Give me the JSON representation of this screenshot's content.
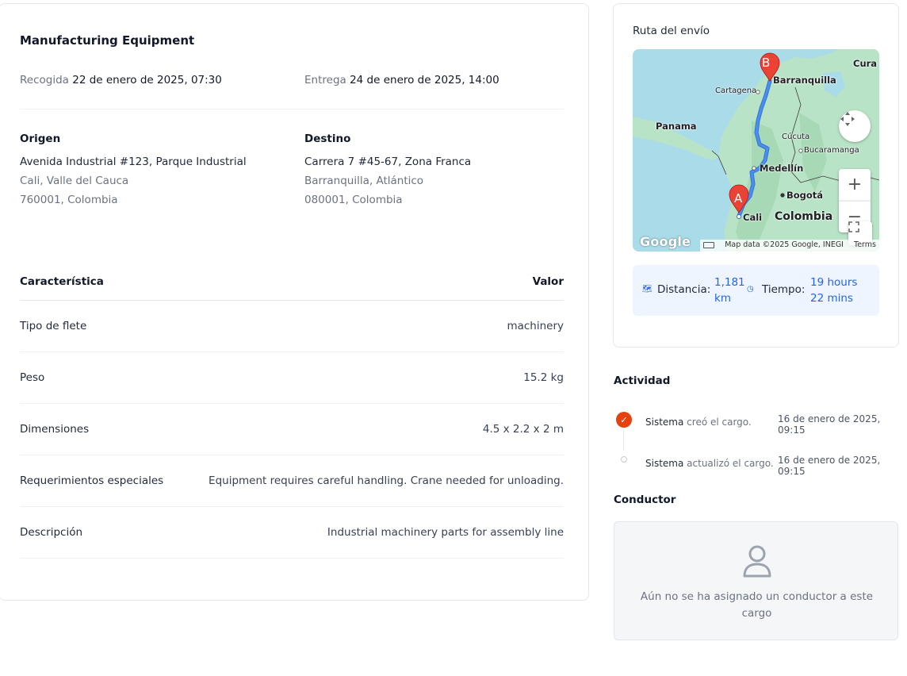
{
  "cargo": {
    "title": "Manufacturing Equipment",
    "pickup_label": "Recogida",
    "pickup_value": "22 de enero de 2025, 07:30",
    "delivery_label": "Entrega",
    "delivery_value": "24 de enero de 2025, 14:00"
  },
  "origin": {
    "heading": "Origen",
    "line1": "Avenida Industrial #123, Parque Industrial",
    "line2": "Cali, Valle del Cauca",
    "line3": "760001, Colombia"
  },
  "destination": {
    "heading": "Destino",
    "line1": "Carrera 7 #45-67, Zona Franca",
    "line2": "Barranquilla, Atlántico",
    "line3": "080001, Colombia"
  },
  "specs": {
    "col_key": "Característica",
    "col_value": "Valor",
    "rows": [
      {
        "key": "Tipo de flete",
        "value": "machinery"
      },
      {
        "key": "Peso",
        "value": "15.2 kg"
      },
      {
        "key": "Dimensiones",
        "value": "4.5 x 2.2 x 2 m"
      },
      {
        "key": "Requerimientos especiales",
        "value": "Equipment requires careful handling. Crane needed for unloading."
      },
      {
        "key": "Descripción",
        "value": "Industrial machinery parts for assembly line"
      }
    ]
  },
  "route": {
    "title": "Ruta del envío",
    "map": {
      "labels": {
        "cura": "Cura",
        "barranquilla": "Barranquilla",
        "cartagena": "Cartagena",
        "panama": "Panama",
        "cucuta": "Cúcuta",
        "bucaramanga": "Bucaramanga",
        "medellin": "Medellín",
        "bogota": "Bogotá",
        "cali": "Cali",
        "colombia": "Colombia"
      },
      "marker_a": "A",
      "marker_b": "B",
      "zoom_in": "+",
      "zoom_out": "−",
      "logo": "Google",
      "attribution": "Map data ©2025 Google, INEGI",
      "terms": "Terms"
    },
    "distance_label": "Distancia:",
    "distance_value": "1,181 km",
    "time_label": "Tiempo:",
    "time_value": "19 hours 22 mins"
  },
  "activity": {
    "title": "Actividad",
    "items": [
      {
        "actor": "Sistema",
        "verb": "creó el cargo.",
        "time": "16 de enero de 2025, 09:15",
        "done": true
      },
      {
        "actor": "Sistema",
        "verb": "actualizó el cargo.",
        "time": "16 de enero de 2025, 09:15",
        "done": false
      }
    ]
  },
  "driver": {
    "title": "Conductor",
    "empty_text": "Aún no se ha asignado un conductor a este cargo"
  },
  "colors": {
    "accent": "#2563eb",
    "activity_done": "#e5420f",
    "map_water": "#a9dbe9",
    "map_land": "#b9e3c6",
    "route_line": "#4a8ff0",
    "marker": "#ea4335"
  }
}
